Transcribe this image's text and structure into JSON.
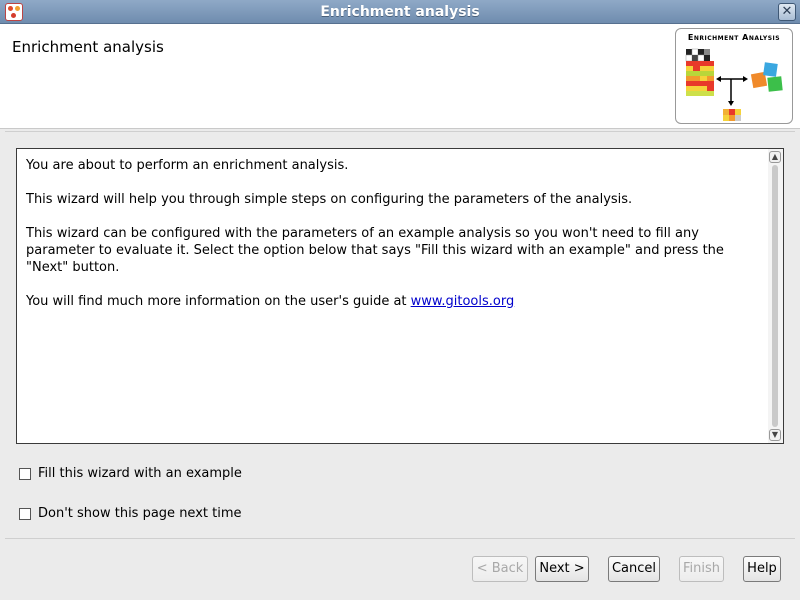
{
  "window": {
    "title": "Enrichment analysis",
    "close_glyph": "✕"
  },
  "header": {
    "title": "Enrichment analysis",
    "logo_text": "Enrichment Analysis"
  },
  "content": {
    "paragraph1": "You are about to perform an enrichment analysis.",
    "paragraph2": "This wizard will help you through simple steps on configuring the parameters of the analysis.",
    "paragraph3": "This wizard can be configured with the parameters of an example analysis so you won't need to fill any parameter to evaluate it. Select the option below that says \"Fill this wizard with an example\" and press the \"Next\" button.",
    "paragraph4_prefix": "You will find much more information on the user's guide at ",
    "link_text": "www.gitools.org"
  },
  "options": {
    "fill_example_label": "Fill this wizard with an example",
    "fill_example_checked": false,
    "dont_show_label": "Don't show this page next time",
    "dont_show_checked": false
  },
  "buttons": {
    "back": "< Back",
    "next": "Next >",
    "cancel": "Cancel",
    "finish": "Finish",
    "help": "Help"
  }
}
